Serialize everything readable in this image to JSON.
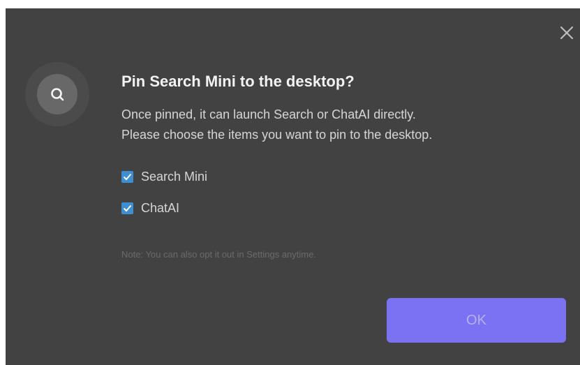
{
  "dialog": {
    "title": "Pin Search Mini to the desktop?",
    "description_line1": "Once pinned, it can launch Search or ChatAI directly.",
    "description_line2": "Please choose the items you want to pin to the desktop.",
    "options": [
      {
        "label": "Search Mini",
        "checked": true
      },
      {
        "label": "ChatAI",
        "checked": true
      }
    ],
    "note": "Note: You can also opt it out in Settings anytime.",
    "ok_label": "OK",
    "icons": {
      "close": "close-icon",
      "app": "search-icon",
      "checkbox": "checkmark-icon"
    },
    "colors": {
      "background": "#424242",
      "accent": "#7a72f2",
      "checkbox": "#3d8fd1"
    }
  }
}
